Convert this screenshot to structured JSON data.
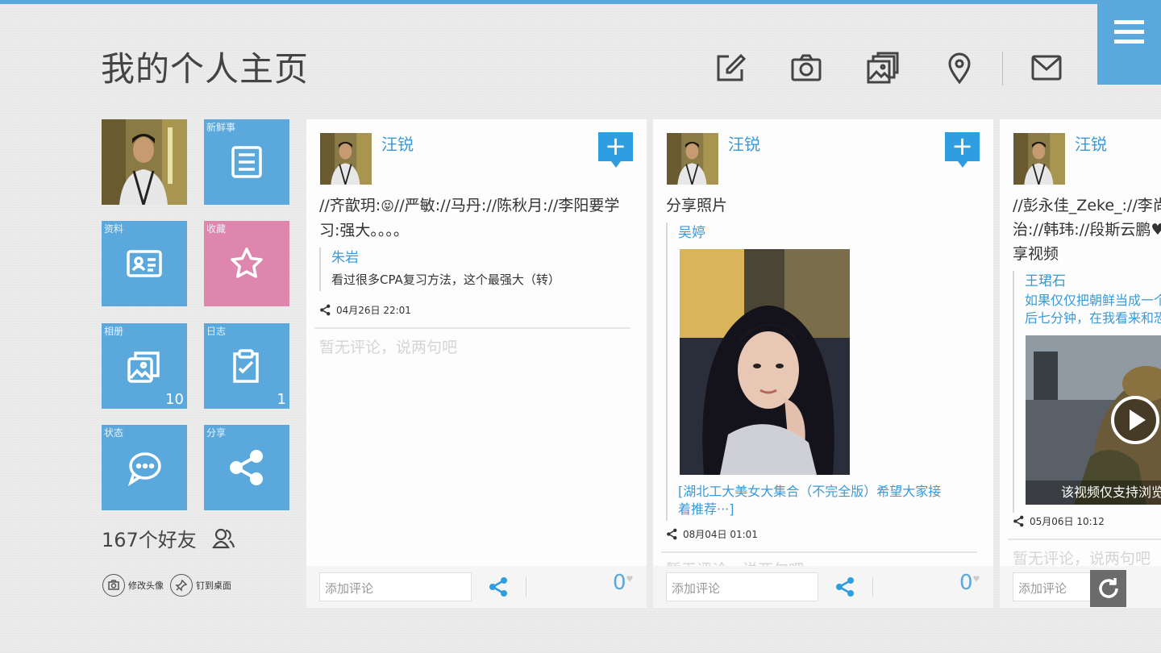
{
  "page": {
    "title": "我的个人主页"
  },
  "toolbar": {
    "icons": [
      "compose-icon",
      "camera-icon",
      "album-icon",
      "location-icon",
      "mail-icon"
    ],
    "menu_icon": "menu-icon"
  },
  "tiles": {
    "news": {
      "label": "新鲜事",
      "icon": "news-icon"
    },
    "profile": {
      "label": "资料",
      "icon": "profile-card-icon"
    },
    "favorites": {
      "label": "收藏",
      "icon": "star-icon"
    },
    "albums": {
      "label": "相册",
      "icon": "album-icon",
      "count": "10"
    },
    "blog": {
      "label": "日志",
      "icon": "notepad-icon",
      "count": "1"
    },
    "status": {
      "label": "状态",
      "icon": "chat-bubble-icon"
    },
    "share": {
      "label": "分享",
      "icon": "share-icon"
    }
  },
  "friends": {
    "text": "167个好友"
  },
  "actions": {
    "change_avatar": "修改头像",
    "pin_desktop": "钉到桌面"
  },
  "colors": {
    "accent": "#5aa8dc",
    "pink": "#de86ad",
    "link": "#3a9ad8"
  },
  "cards": [
    {
      "author": "汪锐",
      "text": "//齐歆玥:😝//严敏://马丹://陈秋月://李阳要学习:强大。。。。",
      "text_line1": "//齐歆玥:",
      "text_emoji": "😝",
      "text_line1b": "//严敏://马丹://陈秋月://李阳要学",
      "text_line2": "习:强大。。。。",
      "quote_name": "朱岩",
      "quote_text": "看过很多CPA复习方法，这个最强大（转）",
      "time": "04月26日 22:01",
      "no_comment": "暂无评论，说两句吧",
      "comment_placeholder": "添加评论",
      "likes": "0"
    },
    {
      "author": "汪锐",
      "text": "分享照片",
      "quote_name": "吴婷",
      "quote_link": "[湖北工大美女大集合（不完全版）希望大家接着推荐···]",
      "quote_link_l1": "[湖北工大美女大集合（不完全版）希望大家接",
      "quote_link_l2": "着推荐···]",
      "time": "08月04日 01:01",
      "no_comment": "暂无评论，说两句吧",
      "comment_placeholder": "添加评论",
      "likes": "0"
    },
    {
      "author": "汪锐",
      "text_line1": "//彭永佳_Zeke_://李尚",
      "text_line2": "治://韩玮://段斯云鹏♥",
      "text_line3": "享视频",
      "quote_name": "王珺石",
      "quote_link_l1": "如果仅仅把朝鲜当成一个",
      "quote_link_l2": "后七分钟，在我看来和恐",
      "video_caption": "该视频仅支持浏览",
      "time": "05月06日 10:12",
      "no_comment": "暂无评论，说两句吧",
      "comment_placeholder": "添加评论"
    }
  ]
}
